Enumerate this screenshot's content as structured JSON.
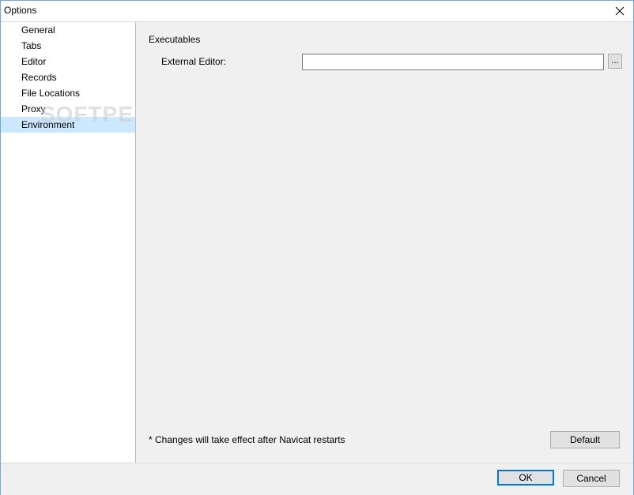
{
  "window": {
    "title": "Options"
  },
  "sidebar": {
    "items": [
      {
        "label": "General"
      },
      {
        "label": "Tabs"
      },
      {
        "label": "Editor"
      },
      {
        "label": "Records"
      },
      {
        "label": "File Locations"
      },
      {
        "label": "Proxy"
      },
      {
        "label": "Environment",
        "selected": true
      }
    ]
  },
  "content": {
    "section_title": "Executables",
    "external_editor": {
      "label": "External Editor:",
      "value": "",
      "browse_label": "..."
    },
    "note": "* Changes will take effect after Navicat restarts",
    "default_label": "Default"
  },
  "footer": {
    "ok_label": "OK",
    "cancel_label": "Cancel"
  },
  "watermark": "SOFTPEDIA",
  "colors": {
    "selected_bg": "#cce8ff",
    "accent": "#0078d7",
    "border": "#6ea7d8"
  }
}
